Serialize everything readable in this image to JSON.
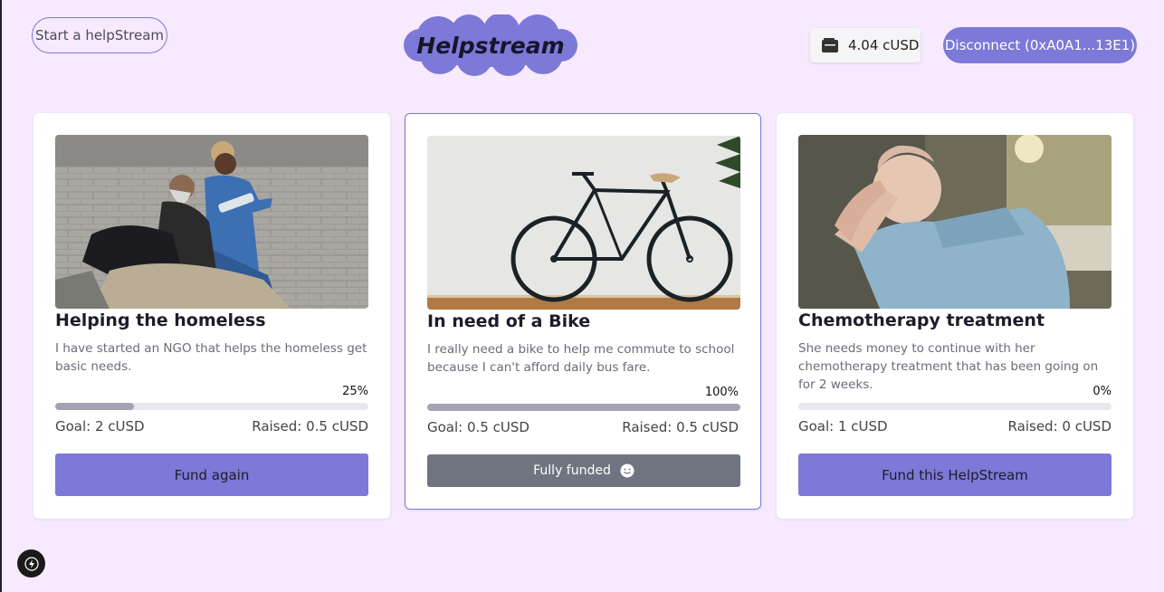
{
  "header": {
    "start_label": "Start a helpStream",
    "logo_text": "Helpstream",
    "balance": "4.04 cUSD",
    "disconnect_label": "Disconnect (0xA0A1...13E1)"
  },
  "colors": {
    "accent": "#7c79d8",
    "background": "#f7eafe",
    "disabled_button": "#6f7480",
    "progress_fill": "#a3a3b3"
  },
  "cards": [
    {
      "image": "homeless-image",
      "title": "Helping the homeless",
      "description": "I have started an NGO that helps the homeless get basic needs.",
      "progress_label": "25%",
      "progress": 0.25,
      "goal": "Goal: 2 cUSD",
      "raised": "Raised: 0.5 cUSD",
      "action_label": "Fund again"
    },
    {
      "image": "bike-image",
      "title": "In need of a Bike",
      "description": "I really need a bike to help me commute to school because I can't afford daily bus fare.",
      "progress_label": "100%",
      "progress": 1.0,
      "goal": "Goal: 0.5 cUSD",
      "raised": "Raised: 0.5 cUSD",
      "action_label": "Fully funded"
    },
    {
      "image": "chemotherapy-image",
      "title": "Chemotherapy treatment",
      "description": "She needs money to continue with her chemotherapy treatment that has been going on for 2 weeks.",
      "progress_label": "0%",
      "progress": 0.0,
      "goal": "Goal: 1 cUSD",
      "raised": "Raised: 0 cUSD",
      "action_label": "Fund this HelpStream"
    }
  ],
  "icons": {
    "wallet": "wallet-icon",
    "smile": "smile-icon",
    "bolt": "bolt-icon"
  }
}
